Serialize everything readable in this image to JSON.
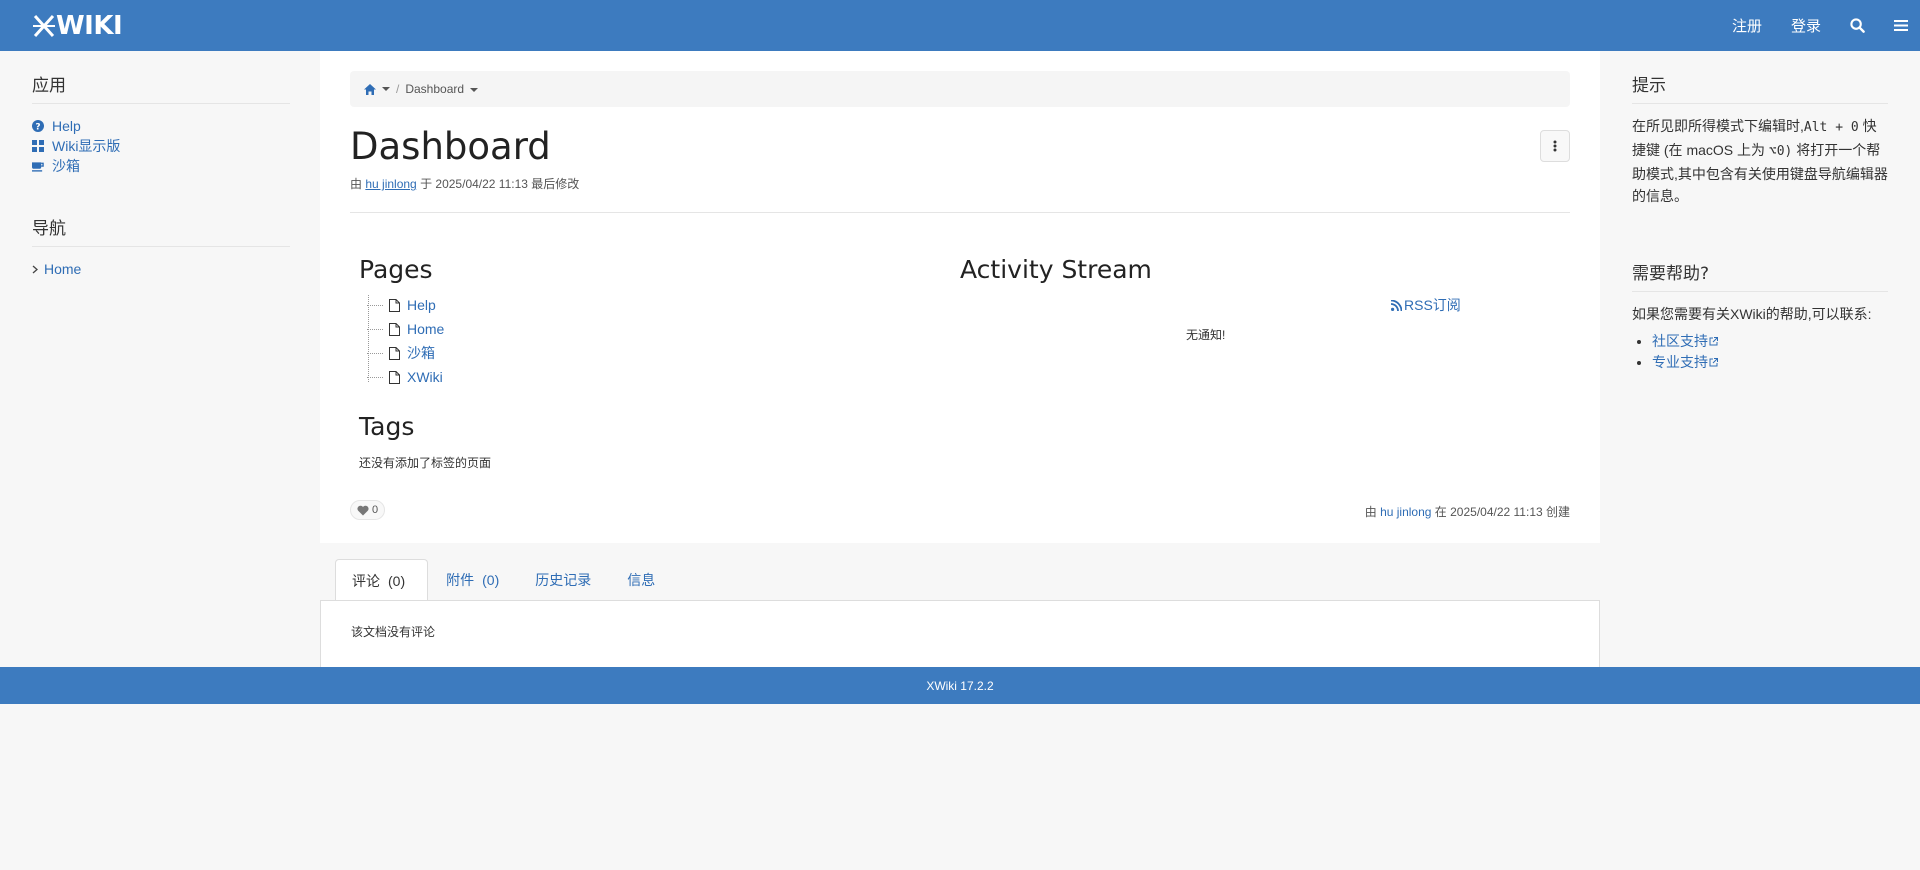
{
  "topbar": {
    "logo_text": "WIKI",
    "register": "注册",
    "login": "登录",
    "search_icon": "search-icon",
    "menu_icon": "hamburger-icon"
  },
  "left": {
    "apps_title": "应用",
    "apps": [
      {
        "label": "Help",
        "icon": "question-circle-icon"
      },
      {
        "label": "Wiki显示版",
        "icon": "grid-icon"
      },
      {
        "label": "沙箱",
        "icon": "coffee-icon"
      }
    ],
    "nav_title": "导航",
    "nav": [
      {
        "label": "Home",
        "icon": "chevron-right-icon"
      }
    ]
  },
  "main": {
    "breadcrumb": {
      "home_icon": "home-icon",
      "separator": "/",
      "page": "Dashboard"
    },
    "title": "Dashboard",
    "meta": {
      "prefix": "由",
      "author": "hu jinlong",
      "middle": "于 2025/04/22 11:13 最后修改"
    },
    "pages_title": "Pages",
    "pages": [
      "Help",
      "Home",
      "沙箱",
      "XWiki"
    ],
    "tags_title": "Tags",
    "tags_empty": "还没有添加了标签的页面",
    "activity_title": "Activity Stream",
    "rss_label": "RSS订阅",
    "no_notifications": "无通知!",
    "likes": "0",
    "created": {
      "prefix": "由",
      "author": "hu jinlong",
      "suffix": "在 2025/04/22 11:13 创建"
    }
  },
  "tabs": {
    "items": [
      {
        "label": "评论",
        "count": "(0)"
      },
      {
        "label": "附件",
        "count": "(0)"
      },
      {
        "label": "历史记录",
        "count": ""
      },
      {
        "label": "信息",
        "count": ""
      }
    ],
    "comments_empty": "该文档没有评论"
  },
  "footer": {
    "version": "XWiki 17.2.2"
  },
  "right": {
    "tip_title": "提示",
    "tip_part1": "在所见即所得模式下编辑时,",
    "tip_code1": "Alt + 0",
    "tip_part2": "快捷键 (在 macOS 上为",
    "tip_code2": "⌥0)",
    "tip_part3": "将打开一个帮助模式,其中包含有关使用键盘导航编辑器的信息。",
    "help_title": "需要帮助?",
    "help_text": "如果您需要有关XWiki的帮助,可以联系:",
    "help_links": [
      "社区支持",
      "专业支持"
    ]
  },
  "colors": {
    "brand": "#3d7bbf",
    "link": "#2f6db5"
  }
}
